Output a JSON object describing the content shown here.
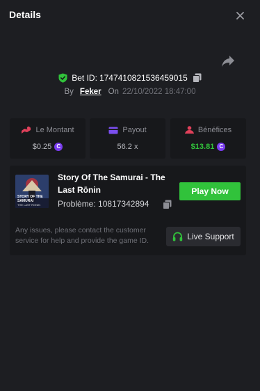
{
  "header": {
    "title": "Details"
  },
  "bet": {
    "id_label": "Bet ID:",
    "id": "1747410821536459015",
    "by_label": "By",
    "user": "Feker",
    "on_label": "On",
    "date": "22/10/2022 18:47:00"
  },
  "stats": [
    {
      "label": "Le Montant",
      "value": "$0.25",
      "icon": "money-icon",
      "icon_color": "#e0405a"
    },
    {
      "label": "Payout",
      "value": "56.2 x",
      "icon": "card-icon",
      "icon_color": "#7b4ef0"
    },
    {
      "label": "Bénéfices",
      "value": "$13.81",
      "icon": "coins-icon",
      "icon_color": "#e0405a"
    }
  ],
  "coin_symbol": "C",
  "game": {
    "title": "Story Of The Samurai - The Last Rōnin",
    "problem_label": "Problème:",
    "problem_id": "10817342894",
    "play_label": "Play Now",
    "thumb_text": [
      "STORY OF THE",
      "SAMURAI",
      "THE LAST RONIN"
    ]
  },
  "support": {
    "notice": "Any issues, please contact the customer service for help and provide the game ID.",
    "button_label": "Live Support"
  },
  "colors": {
    "background": "#1d1e22",
    "card": "#17181b",
    "accent_green": "#31c23b",
    "coin_purple": "#7a3cf0"
  }
}
